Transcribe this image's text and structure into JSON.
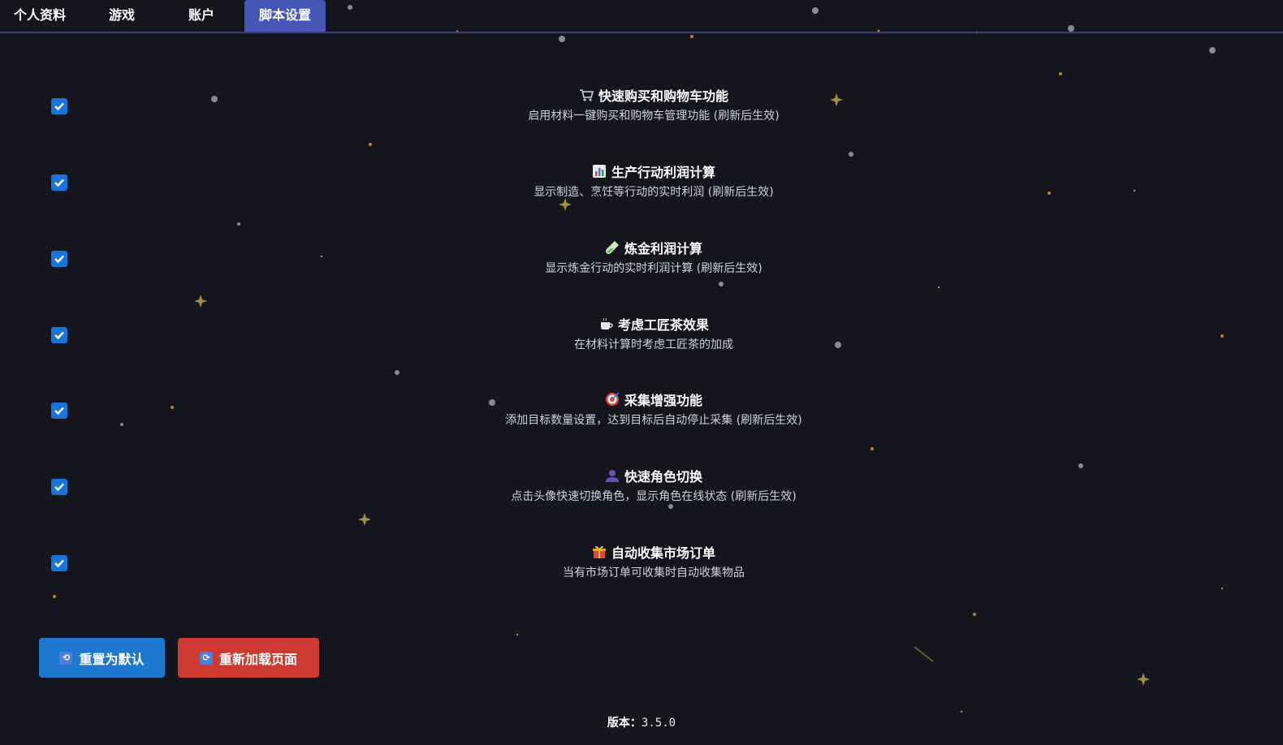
{
  "tabs": [
    {
      "label": "个人资料"
    },
    {
      "label": "游戏"
    },
    {
      "label": "账户"
    },
    {
      "label": "脚本设置",
      "active": true
    }
  ],
  "settings": [
    {
      "icon": "shopping-cart-icon",
      "title": "快速购买和购物车功能",
      "desc": "启用材料一键购买和购物车管理功能 (刷新后生效)",
      "checked": true
    },
    {
      "icon": "bar-chart-icon",
      "title": "生产行动利润计算",
      "desc": "显示制造、烹饪等行动的实时利润 (刷新后生效)",
      "checked": true
    },
    {
      "icon": "test-tube-icon",
      "title": "炼金利润计算",
      "desc": "显示炼金行动的实时利润计算 (刷新后生效)",
      "checked": true
    },
    {
      "icon": "tea-cup-icon",
      "title": "考虑工匠茶效果",
      "desc": "在材料计算时考虑工匠茶的加成",
      "checked": true
    },
    {
      "icon": "target-icon",
      "title": "采集增强功能",
      "desc": "添加目标数量设置，达到目标后自动停止采集 (刷新后生效)",
      "checked": true
    },
    {
      "icon": "user-silhouette-icon",
      "title": "快速角色切换",
      "desc": "点击头像快速切换角色，显示角色在线状态 (刷新后生效)",
      "checked": true
    },
    {
      "icon": "gift-icon",
      "title": "自动收集市场订单",
      "desc": "当有市场订单可收集时自动收集物品",
      "checked": true
    }
  ],
  "buttons": {
    "reset_label": "重置为默认",
    "reload_label": "重新加载页面"
  },
  "version": {
    "label": "版本：",
    "value": "3.5.0"
  },
  "colors": {
    "background": "#15151e",
    "active_tab": "#4656b6",
    "checkbox": "#1a73d9",
    "reset_button": "#1f78cf",
    "reload_button": "#cc3a31"
  }
}
